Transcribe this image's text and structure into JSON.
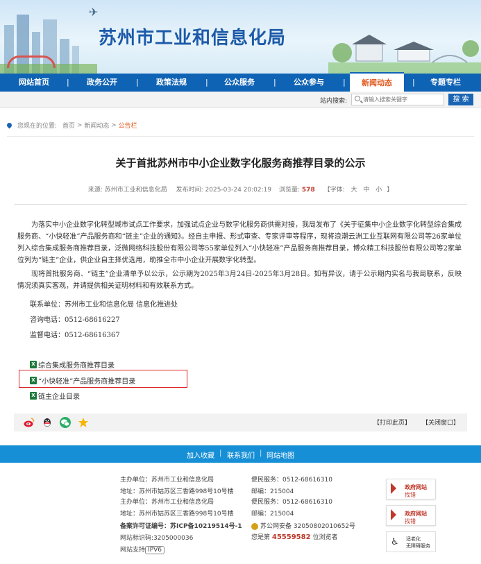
{
  "header": {
    "site_title": "苏州市工业和信息化局"
  },
  "nav": {
    "items": [
      {
        "label": "网站首页"
      },
      {
        "label": "政务公开"
      },
      {
        "label": "政策法规"
      },
      {
        "label": "公众服务"
      },
      {
        "label": "公众参与"
      },
      {
        "label": "新闻动态",
        "active": true
      },
      {
        "label": "专题专栏"
      }
    ],
    "separator": "|"
  },
  "search": {
    "label": "站内搜索:",
    "placeholder": "请输入搜索关键字",
    "button": "搜 索"
  },
  "breadcrumb": {
    "prefix": "您现在的位置:",
    "home": "首页",
    "sep": " > ",
    "news": "新闻动态",
    "current": "公告栏"
  },
  "article": {
    "title": "关于首批苏州市中小企业数字化服务商推荐目录的公示",
    "meta": {
      "source_label": "来源:",
      "source": "苏州市工业和信息化局",
      "time_label": "发布时间:",
      "time": "2025-03-24 20:02:19",
      "views_label": "浏览量:",
      "views": "578",
      "font_label": "【字体:",
      "font_large": "大",
      "font_mid": "中",
      "font_small": "小",
      "font_close": "】"
    },
    "para1": "为落实中小企业数字化转型城市试点工作要求，加强试点企业与数字化服务商供需对接，我局发布了《关于征集中小企业数字化转型综合集成服务商、“小快轻准”产品服务商和“链主”企业的通知》。经自主申报、形式审查、专家评审等程序，现将浪潮云洲工业互联网有限公司等26家单位列入综合集成服务商推荐目录，泛微网络科技股份有限公司等55家单位列入“小快轻准”产品服务商推荐目录，博众精工科技股份有限公司等2家单位列为“链主”企业，供企业自主择优选用，助推全市中小企业开展数字化转型。",
    "para2": "现将首批服务商、“链主”企业清单予以公示，公示期为2025年3月24日-2025年3月28日。如有异议，请于公示期内实名与我局联系，反映情况须真实客观，并请提供相关证明材料和有效联系方式。",
    "contact_unit": "联系单位：苏州市工业和信息化局 信息化推进处",
    "consult_phone": "咨询电话：0512-68616227",
    "supervise_phone": "监督电话：0512-68616367",
    "attachments": [
      {
        "label": "综合集成服务商推荐目录"
      },
      {
        "label": "“小快轻准”产品服务商推荐目录"
      },
      {
        "label": "链主企业目录"
      }
    ],
    "xls_glyph": "X"
  },
  "sharebar": {
    "print": "【打印此页】",
    "close": "【关闭窗口】"
  },
  "footer": {
    "links": [
      "加入收藏",
      "联系我们",
      "网站地图"
    ],
    "link_sep": "|",
    "host": "主办单位：苏州市工业和信息化局",
    "service": "便民服务：0512-68616310",
    "address": "地址：苏州市姑苏区三香路998号10号楼",
    "postcode": "邮编：215004",
    "host2": "主办单位：苏州市工业和信息化局",
    "service2": "便民服务：0512-68616310",
    "address2": "地址：苏州市姑苏区三香路998号10号楼",
    "postcode2": "邮编：215004",
    "icp": "备案许可证编号：苏ICP备10219514号-1",
    "police": "苏公网安备 32050802010652号",
    "site_id": "网站标识码:3205000036",
    "visitors_prefix": "您是第",
    "visitors": "45559582",
    "visitors_suffix": "位浏览者",
    "ipv6_prefix": "网站支持",
    "ipv6": "IPV6",
    "badge1": {
      "line1": "政府网站",
      "line2": "找错"
    },
    "badge2": {
      "line1": "政府网站",
      "line2": "找错"
    },
    "accessibility": {
      "line1": "适老化",
      "line2": "无障碍服务"
    }
  },
  "colors": {
    "nav_bg": "#0f63b4",
    "active": "#e0571b",
    "footer_bar": "#168fd6",
    "highlight_box": "#dd2222"
  }
}
